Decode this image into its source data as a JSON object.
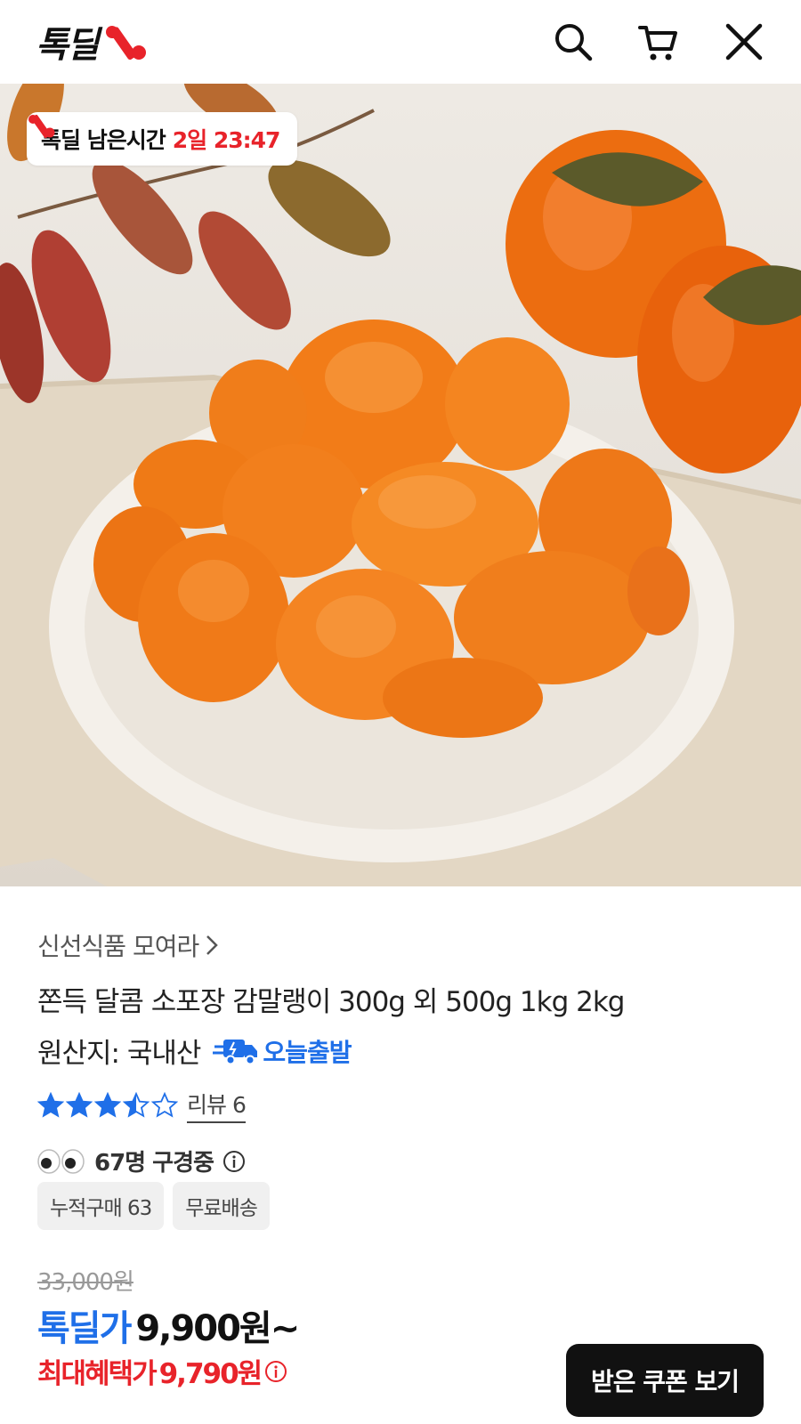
{
  "header": {
    "logo_text": "톡딜",
    "icons": [
      "search-icon",
      "cart-icon",
      "close-icon"
    ]
  },
  "hero": {
    "timer_label": "톡딜 남은시간",
    "timer_value": "2일 23:47"
  },
  "product": {
    "seller": "신선식품 모여라",
    "title": "쫀득 달콤 소포장 감말랭이 300g 외 500g 1kg 2kg",
    "origin": "원산지: 국내산",
    "shipping_badge": "오늘출발",
    "rating": 3.5,
    "review_label": "리뷰 6",
    "viewers": "67명 구경중",
    "tags": [
      "누적구매 63",
      "무료배송"
    ],
    "original_price": "33,000원",
    "deal_label": "톡딜가",
    "deal_price": "9,900원~",
    "max_benefit_label": "최대혜택가",
    "max_benefit_price": "9,790원"
  },
  "actions": {
    "coupon_button": "받은 쿠폰 보기"
  },
  "colors": {
    "brand_red": "#e8232a",
    "accent_blue": "#1f6fe8",
    "dark": "#111111"
  }
}
